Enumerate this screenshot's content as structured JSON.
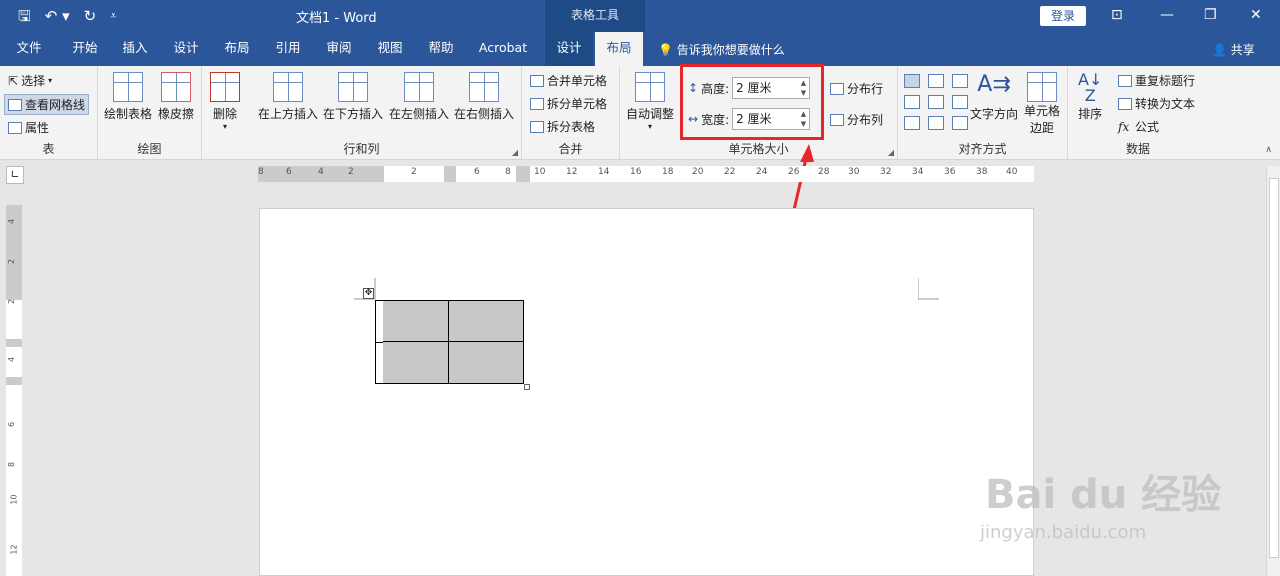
{
  "titlebar": {
    "doc_title": "文档1  -  Word",
    "context_tools": "表格工具",
    "login": "登录"
  },
  "tabs": {
    "file": "文件",
    "home": "开始",
    "insert": "插入",
    "design": "设计",
    "layout": "布局",
    "references": "引用",
    "review": "审阅",
    "view": "视图",
    "help": "帮助",
    "acrobat": "Acrobat",
    "tbl_design": "设计",
    "tbl_layout": "布局"
  },
  "tell_me": "告诉我你想要做什么",
  "share": "共享",
  "ribbon": {
    "table": {
      "label": "表",
      "select": "选择",
      "gridlines": "查看网格线",
      "properties": "属性"
    },
    "draw": {
      "label": "绘图",
      "draw_table": "绘制表格",
      "eraser": "橡皮擦"
    },
    "rows_cols": {
      "label": "行和列",
      "delete": "删除",
      "above": "在上方插入",
      "below": "在下方插入",
      "left": "在左侧插入",
      "right": "在右侧插入"
    },
    "merge": {
      "label": "合并",
      "merge_cells": "合并单元格",
      "split_cells": "拆分单元格",
      "split_table": "拆分表格"
    },
    "cell_size": {
      "label": "单元格大小",
      "autofit": "自动调整",
      "height_label": "高度:",
      "height_value": "2 厘米",
      "width_label": "宽度:",
      "width_value": "2 厘米",
      "dist_rows": "分布行",
      "dist_cols": "分布列"
    },
    "alignment": {
      "label": "对齐方式",
      "text_dir": "文字方向",
      "margins_line1": "单元格",
      "margins_line2": "边距"
    },
    "data": {
      "label": "数据",
      "sort": "排序",
      "repeat_header": "重复标题行",
      "to_text": "转换为文本",
      "formula": "公式"
    }
  },
  "hruler_ticks": [
    "8",
    "6",
    "4",
    "2",
    "2",
    "6",
    "8",
    "10",
    "12",
    "14",
    "16",
    "18",
    "20",
    "22",
    "24",
    "26",
    "28",
    "30",
    "32",
    "34",
    "36",
    "38",
    "40"
  ],
  "vruler_ticks": [
    "4",
    "2",
    "2",
    "4",
    "6",
    "8",
    "10",
    "12"
  ],
  "watermark": {
    "logo": "Bai du 经验",
    "url": "jingyan.baidu.com"
  }
}
